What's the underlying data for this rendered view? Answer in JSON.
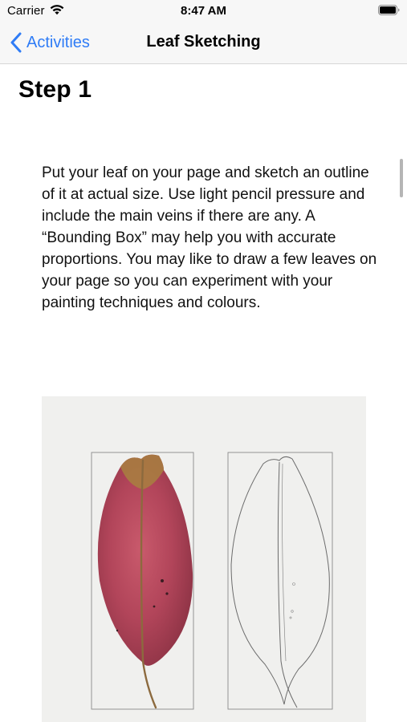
{
  "status_bar": {
    "carrier": "Carrier",
    "time": "8:47 AM",
    "wifi_icon": "wifi-icon",
    "battery_icon": "battery-icon"
  },
  "nav": {
    "back_label": "Activities",
    "back_icon": "chevron-left-icon",
    "title": "Leaf Sketching",
    "accent_color": "#2f7cf6"
  },
  "content": {
    "step_title": "Step 1",
    "body": "Put your leaf on your page and sketch an outline of it at actual size. Use light pencil pressure and include the main veins if there are any. A “Bounding Box” may help you with accurate proportions. You may like to draw a few leaves on your page so you can experiment with your painting techniques and colours."
  }
}
